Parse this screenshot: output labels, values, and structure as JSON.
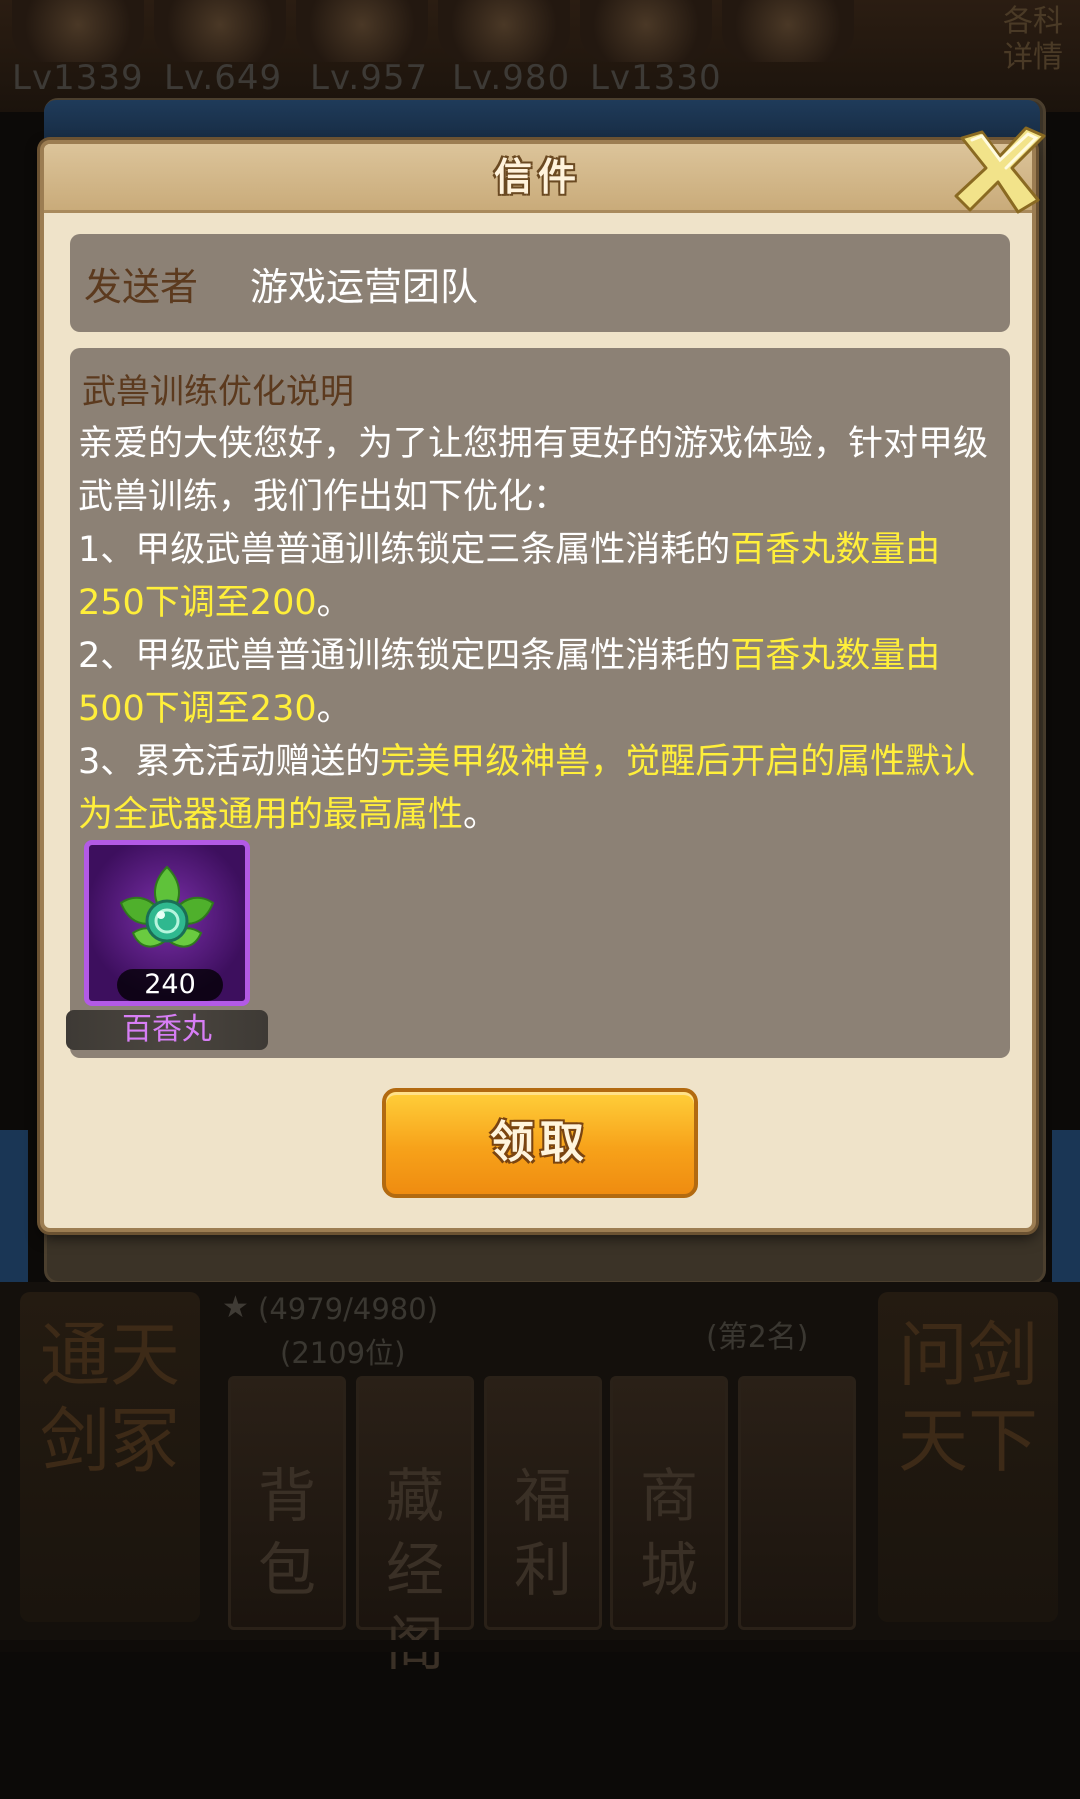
{
  "background": {
    "levels": [
      "Lv1339",
      "Lv.649",
      "Lv.957",
      "Lv.980",
      "Lv1330"
    ],
    "corner_text": "各科\n详情",
    "star_progress": "(4979/4980)",
    "count_text": "(2109位)",
    "rank_text": "(第2名)",
    "side_left": "通天剑冢",
    "side_right": "问剑天下",
    "menu_items": [
      "背包",
      "藏经阁",
      "福利",
      "商城",
      ""
    ]
  },
  "dialog": {
    "title": "信件",
    "sender_label": "发送者",
    "sender_name": "游戏运营团队",
    "subject": "武兽训练优化说明",
    "body": {
      "intro": "亲爱的大侠您好，为了让您拥有更好的游戏体验，针对甲级武兽训练，我们作出如下优化：",
      "item1_prefix": "1、甲级武兽普通训练锁定三条属性消耗的",
      "item1_highlight": "百香丸数量由250下调至200",
      "item1_suffix": "。",
      "item2_prefix": "2、甲级武兽普通训练锁定四条属性消耗的",
      "item2_highlight": "百香丸数量由500下调至230",
      "item2_suffix": "。",
      "item3_prefix": "3、累充活动赠送的",
      "item3_highlight": "完美甲级神兽，觉醒后开启的属性默认为全武器通用的最高属性",
      "item3_suffix": "。"
    },
    "reward": {
      "count": "240",
      "name": "百香丸",
      "icon": "leaf-pill-icon"
    },
    "claim_label": "领取"
  },
  "colors": {
    "highlight": "#ffef3a",
    "reward_name": "#d77ef5",
    "panel": "#8c8175",
    "dialog_bg": "#efe3c9"
  }
}
